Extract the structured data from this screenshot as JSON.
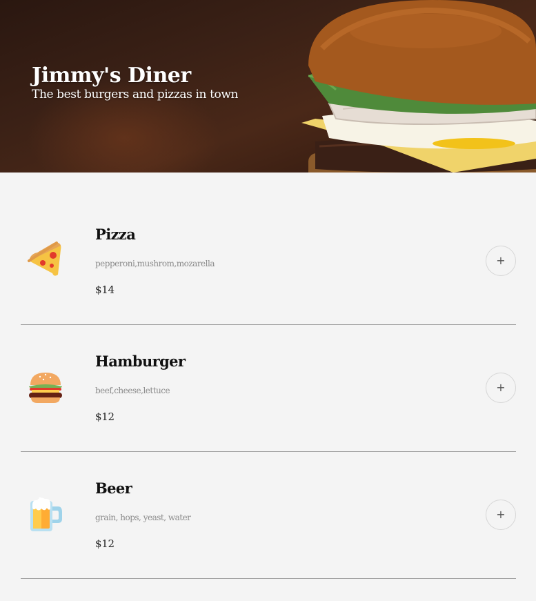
{
  "hero": {
    "title": "Jimmy's Diner",
    "subtitle": "The best burgers and pizzas in town"
  },
  "menu": {
    "items": [
      {
        "icon": "pizza-icon",
        "name": "Pizza",
        "ingredients": "pepperoni,mushrom,mozarella",
        "price": "$14",
        "add_label": "+"
      },
      {
        "icon": "hamburger-icon",
        "name": "Hamburger",
        "ingredients": "beef,cheese,lettuce",
        "price": "$12",
        "add_label": "+"
      },
      {
        "icon": "beer-icon",
        "name": "Beer",
        "ingredients": "grain, hops, yeast, water",
        "price": "$12",
        "add_label": "+"
      }
    ]
  },
  "colors": {
    "background": "#f4f4f4",
    "divider": "#9a9a9a",
    "hero_text": "#ffffff",
    "ingredients_text": "#8a8a8a"
  }
}
